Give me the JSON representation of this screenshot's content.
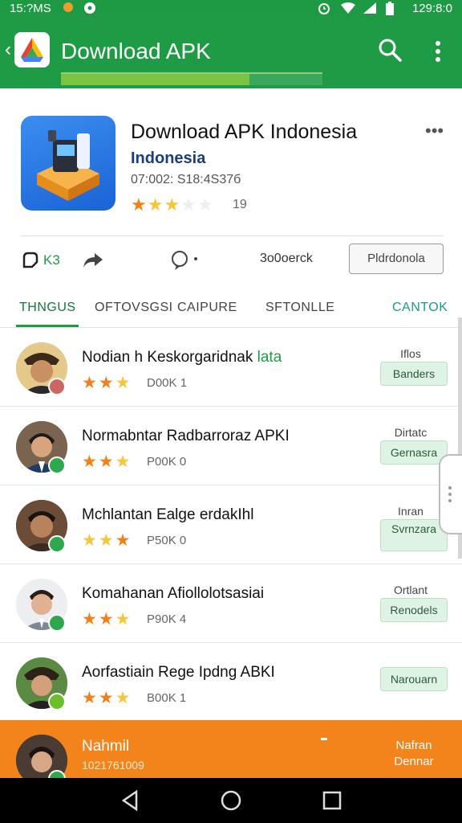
{
  "status_bar": {
    "time_left": "15:?MS",
    "time_right": "129:8:0"
  },
  "app_bar": {
    "title": "Download APK",
    "back_icon": "chevron-left-icon",
    "search_icon": "search-icon",
    "more_icon": "more-vert-icon",
    "progress": 0.72
  },
  "app": {
    "name": "Download APK Indonesia",
    "subtitle": "Indonesia",
    "meta": "07:002: S18:4S37б",
    "rating_stars": 3,
    "rating_count": "19"
  },
  "actions": {
    "like_label": "K3",
    "share_icon": "share-icon",
    "comment_icon": "comment-icon",
    "middle_label": "3o0oerck",
    "install_label": "Pldrdonola"
  },
  "tabs": [
    {
      "label": "THNGUS",
      "active": true
    },
    {
      "label": "OFTOVSGSI",
      "active": false
    },
    {
      "label": "CAIPURE",
      "active": false
    },
    {
      "label": "SFTONLLE",
      "active": false
    },
    {
      "label": "CANTOK",
      "active": false
    }
  ],
  "list": [
    {
      "title": "Nodian h Keskorgaridnak",
      "title_extra": "lata",
      "count": "D00K 1",
      "top": "Iflos",
      "tag": "Banders",
      "badge": "#c66"
    },
    {
      "title": "Normabntar Radbarroraz APKI",
      "title_extra": "",
      "count": "P00K 0",
      "top": "Dirtatc",
      "tag": "Gernasra",
      "badge": "#2ea84d"
    },
    {
      "title": "Mchlantan Ealge erdakIhl",
      "title_extra": "",
      "count": "P50K 0",
      "top": "Inran",
      "tag": "Svrnzara",
      "badge": "#2ea84d"
    },
    {
      "title": "Komahanan Afiollolotsasiai",
      "title_extra": "",
      "count": "P90K 4",
      "top": "Ortlant",
      "tag": "Renodels",
      "badge": "#2ea84d"
    },
    {
      "title": "Aorfastiain Rege Ipdng ABKI",
      "title_extra": "",
      "count": "B00K 1",
      "top": "",
      "tag": "Narouarn",
      "badge": "#6bbf2a"
    }
  ],
  "featured": {
    "title": "Nahmil",
    "sub": "1021761009",
    "right_top": "Nafran",
    "right_bottom": "Dennar"
  },
  "colors": {
    "green": "#1f9b45",
    "orange": "#f3831b",
    "star_orange": "#f47f17",
    "star_yellow": "#f7c53a"
  }
}
